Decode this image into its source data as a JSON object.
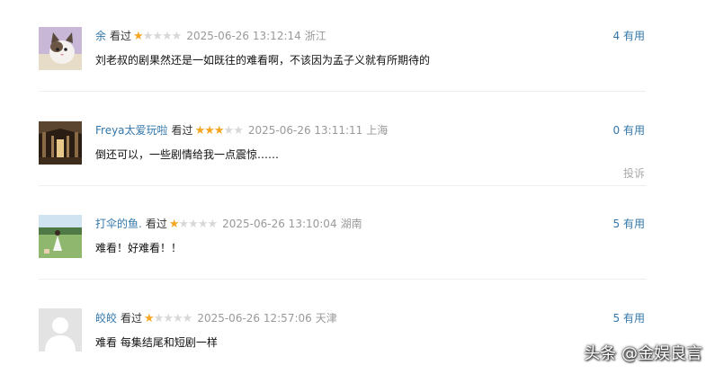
{
  "comments": [
    {
      "username": "余",
      "action": "看过",
      "rating": 1,
      "datetime": "2025-06-26 13:12:14",
      "location": "浙江",
      "useful": "4 有用",
      "text": "刘老叔的剧果然还是一如既往的难看啊，不该因为孟子义就有所期待的",
      "avatar": "cat-photo"
    },
    {
      "username": "Freya太爱玩啦",
      "action": "看过",
      "rating": 3,
      "datetime": "2025-06-26 13:11:11",
      "location": "上海",
      "useful": "0 有用",
      "text": "倒还可以，一些剧情给我一点震惊……",
      "report": "投诉",
      "avatar": "hall-photo"
    },
    {
      "username": "打伞的鱼.",
      "action": "看过",
      "rating": 1,
      "datetime": "2025-06-26 13:10:04",
      "location": "湖南",
      "useful": "5 有用",
      "text": "难看！好难看！！",
      "avatar": "girl-field-photo"
    },
    {
      "username": "皎皎",
      "action": "看过",
      "rating": 1,
      "datetime": "2025-06-26 12:57:06",
      "location": "天津",
      "useful": "5 有用",
      "text": "难看 每集结尾和短剧一样",
      "avatar": "default-user"
    }
  ],
  "watermark": "头条 @金娱良言",
  "colors": {
    "link": "#3377aa",
    "star": "#f5a623",
    "star_empty": "#d8d8d8",
    "meta": "#999999"
  }
}
